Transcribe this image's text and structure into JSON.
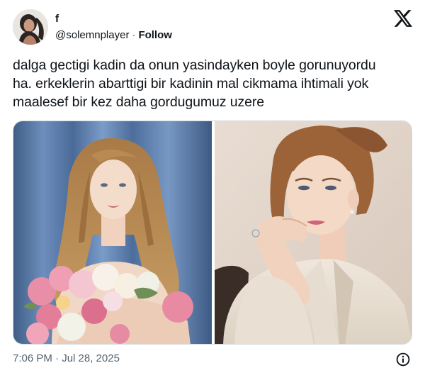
{
  "author": {
    "name": "f",
    "handle": "@solemnplayer",
    "separator": "·",
    "follow_label": "Follow",
    "avatar_icon": "user-avatar"
  },
  "brand": {
    "logo_icon": "x-logo-icon"
  },
  "tweet": {
    "lines": [
      "dalga gectigi kadin da onun yasindayken boyle gorunuyordu",
      "ha. erkeklerin abarttigi bir kadinin mal cikmama ihtimali yok",
      "maalesef bir kez daha gordugumuz uzere"
    ]
  },
  "media": {
    "count": 2,
    "photos": [
      "portrait-with-flowers",
      "portrait-hand-on-chin"
    ]
  },
  "footer": {
    "timestamp": "7:06 PM · Jul 28, 2025",
    "info_icon": "info-icon"
  },
  "colors": {
    "text": "#0f1419",
    "secondary": "#536471",
    "border": "#cfd9de"
  }
}
